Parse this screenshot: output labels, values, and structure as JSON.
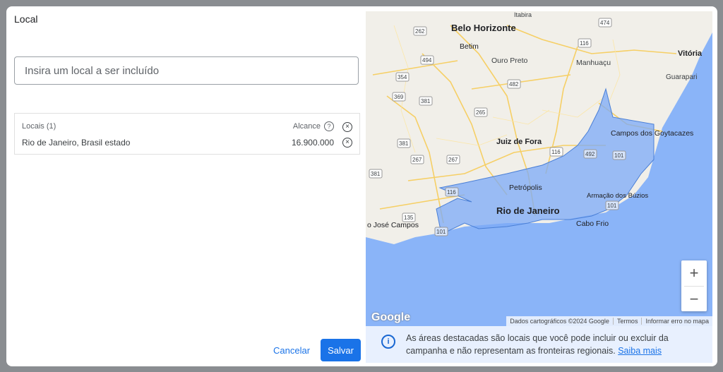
{
  "dialog": {
    "title": "Local",
    "search": {
      "placeholder": "Insira um local a ser incluído",
      "value": ""
    },
    "locations": {
      "header_label": "Locais (1)",
      "reach_label": "Alcance",
      "rows": [
        {
          "name": "Rio de Janeiro, Brasil estado",
          "reach": "16.900.000"
        }
      ]
    },
    "buttons": {
      "cancel": "Cancelar",
      "save": "Salvar"
    }
  },
  "map": {
    "cities": {
      "belo_horizonte": "Belo Horizonte",
      "betim": "Betim",
      "ouro_preto": "Ouro Preto",
      "manhuacu": "Manhuaçu",
      "vitoria": "Vitória",
      "guarapari": "Guarapari",
      "itabira": "Itabira",
      "juiz_de_fora": "Juiz de Fora",
      "campos": "Campos dos Goytacazes",
      "petropolis": "Petrópolis",
      "rio": "Rio de Janeiro",
      "armacao": "Armação dos Búzios",
      "cabo_frio": "Cabo Frio",
      "sao_jose": "o José Campos"
    },
    "road_shields": [
      "262",
      "474",
      "494",
      "116",
      "354",
      "482",
      "369",
      "381",
      "265",
      "381",
      "116",
      "492",
      "101",
      "267",
      "267",
      "381",
      "116",
      "101",
      "135",
      "101"
    ],
    "zoom_in": "+",
    "zoom_out": "−",
    "google_logo": "Google",
    "attribution": {
      "data": "Dados cartográficos ©2024 Google",
      "terms": "Termos",
      "report": "Informar erro no mapa"
    },
    "highlight_color": "#7baaf7"
  },
  "info": {
    "icon": "info-icon",
    "text": "As áreas destacadas são locais que você pode incluir ou excluir da campanha e não representam as fronteiras regionais.",
    "link": "Saiba mais"
  }
}
